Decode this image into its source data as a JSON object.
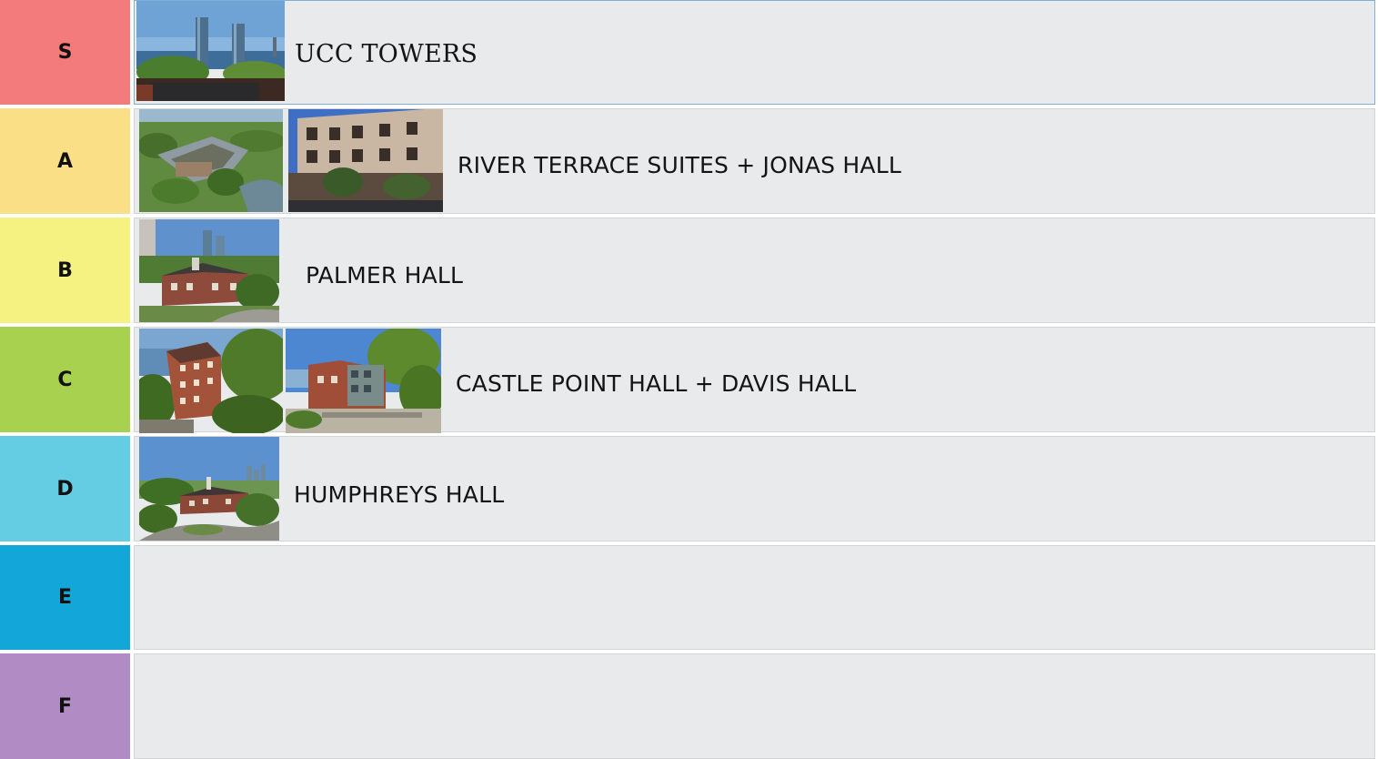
{
  "tiers": [
    {
      "label": "S",
      "color": "#f47b7b",
      "item_text": "UCC TOWERS"
    },
    {
      "label": "A",
      "color": "#fbdf86",
      "item_text": "RIVER TERRACE SUITES + JONAS HALL"
    },
    {
      "label": "B",
      "color": "#f5f281",
      "item_text": "PALMER HALL"
    },
    {
      "label": "C",
      "color": "#a9d150",
      "item_text": "CASTLE POINT HALL + DAVIS HALL"
    },
    {
      "label": "D",
      "color": "#64cde3",
      "item_text": "HUMPHREYS HALL"
    },
    {
      "label": "E",
      "color": "#12a7d8",
      "item_text": ""
    },
    {
      "label": "F",
      "color": "#b18cc4",
      "item_text": ""
    }
  ],
  "icons": {
    "photo": "building-photo"
  }
}
